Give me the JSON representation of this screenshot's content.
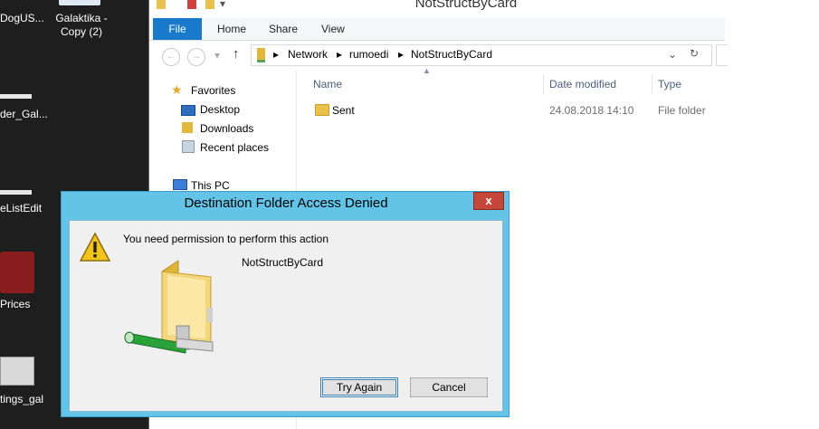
{
  "desktop": {
    "icons": [
      {
        "label": "DogUS..."
      },
      {
        "label": "Galaktika -\nCopy (2)"
      },
      {
        "label": "der_Gal..."
      },
      {
        "label": "eListEdit"
      },
      {
        "label": "Prices"
      },
      {
        "label": "tings_gal"
      }
    ]
  },
  "explorer": {
    "title": "NotStructByCard",
    "ribbon_tabs": [
      "File",
      "Home",
      "Share",
      "View"
    ],
    "breadcrumb": [
      "Network",
      "rumoedi",
      "NotStructByCard"
    ],
    "nav": {
      "favorites": "Favorites",
      "items": [
        "Desktop",
        "Downloads",
        "Recent places"
      ],
      "this_pc": "This PC"
    },
    "columns": [
      "Name",
      "Date modified",
      "Type"
    ],
    "rows": [
      {
        "name": "Sent",
        "date": "24.08.2018 14:10",
        "type": "File folder"
      }
    ]
  },
  "dialog": {
    "title": "Destination Folder Access Denied",
    "message": "You need permission to perform this action",
    "item": "NotStructByCard",
    "try_again": "Try Again",
    "cancel": "Cancel",
    "close_glyph": "x"
  }
}
